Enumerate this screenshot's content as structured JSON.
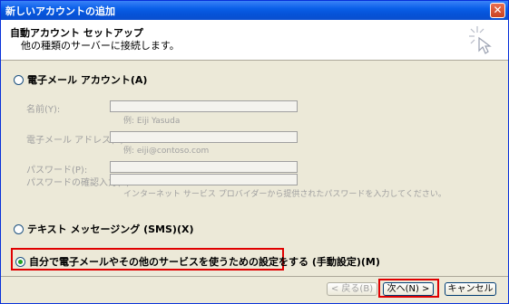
{
  "window": {
    "title": "新しいアカウントの追加",
    "close_label": "✕"
  },
  "header": {
    "title": "自動アカウント セットアップ",
    "subtitle": "他の種類のサーバーに接続します。"
  },
  "options": {
    "email": "電子メール アカウント(A)",
    "sms": "テキスト メッセージング (SMS)(X)",
    "manual": "自分で電子メールやその他のサービスを使うための設定をする (手動設定)(M)",
    "selected": "manual"
  },
  "fields": {
    "name": {
      "label": "名前(Y):",
      "value": "",
      "example": "例: Eiji Yasuda"
    },
    "email": {
      "label": "電子メール アドレス(E):",
      "value": "",
      "example": "例: eiji@contoso.com"
    },
    "password": {
      "label": "パスワード(P):",
      "value": ""
    },
    "password_confirm": {
      "label": "パスワードの確認入力(T):",
      "value": ""
    },
    "password_hint": "インターネット サービス プロバイダーから提供されたパスワードを入力してください。"
  },
  "buttons": {
    "back": "< 戻る(B)",
    "next": "次へ(N) >",
    "cancel": "キャンセル"
  },
  "colors": {
    "titlebar": "#0a5fe8",
    "highlight": "#e00000",
    "dialog_bg": "#ece9d8"
  }
}
